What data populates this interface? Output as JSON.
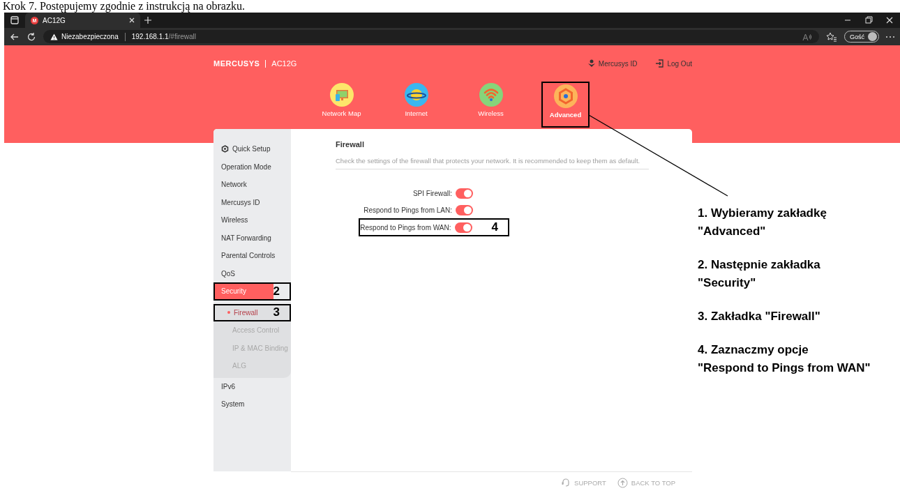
{
  "caption": "Krok 7. Postępujemy zgodnie z instrukcją na obrazku.",
  "browser": {
    "tab_favicon": "M",
    "tab_title": "AC12G",
    "security_label": "Niezabezpieczona",
    "url_host": "192.168.1.1",
    "url_path": "/#firewall",
    "profile_label": "Gość"
  },
  "router": {
    "brand": "MERCUSYS",
    "model": "AC12G",
    "account_link": "Mercusys ID",
    "logout_link": "Log Out",
    "nav": [
      {
        "label": "Network Map",
        "kind": "network-map",
        "selected": false,
        "annotated": false
      },
      {
        "label": "Internet",
        "kind": "internet",
        "selected": false,
        "annotated": false
      },
      {
        "label": "Wireless",
        "kind": "wireless",
        "selected": false,
        "annotated": false
      },
      {
        "label": "Advanced",
        "kind": "advanced",
        "selected": true,
        "annotated": true
      }
    ],
    "sidebar": [
      {
        "label": "Quick Setup",
        "kind": "setup",
        "selected": false
      },
      {
        "label": "Operation Mode",
        "kind": "item",
        "selected": false
      },
      {
        "label": "Network",
        "kind": "item",
        "selected": false
      },
      {
        "label": "Mercusys ID",
        "kind": "item",
        "selected": false
      },
      {
        "label": "Wireless",
        "kind": "item",
        "selected": false
      },
      {
        "label": "NAT Forwarding",
        "kind": "item",
        "selected": false
      },
      {
        "label": "Parental Controls",
        "kind": "item",
        "selected": false
      },
      {
        "label": "QoS",
        "kind": "item",
        "selected": false
      },
      {
        "label": "Security",
        "kind": "item",
        "selected": true,
        "expanded": true,
        "marker": "2",
        "children": [
          {
            "label": "Firewall",
            "selected": true,
            "marker": "3"
          },
          {
            "label": "Access Control",
            "selected": false
          },
          {
            "label": "IP & MAC Binding",
            "selected": false
          },
          {
            "label": "ALG",
            "selected": false
          }
        ]
      },
      {
        "label": "IPv6",
        "kind": "item",
        "selected": false
      },
      {
        "label": "System",
        "kind": "item",
        "selected": false
      }
    ],
    "page_title": "Firewall",
    "description": "Check the settings of the firewall that protects your network. It is recommended to keep them as default.",
    "settings": [
      {
        "label": "SPI Firewall:",
        "on": true
      },
      {
        "label": "Respond to Pings from LAN:",
        "on": true
      },
      {
        "label": "Respond to Pings from WAN:",
        "on": true,
        "marker": "4"
      }
    ],
    "footer": {
      "support": "SUPPORT",
      "back_to_top": "BACK TO TOP"
    }
  },
  "instructions": [
    {
      "lines": [
        "1. Wybieramy zakładkę",
        "\"Advanced\""
      ]
    },
    {
      "lines": [
        "2. Następnie zakładka",
        "\"Security\""
      ]
    },
    {
      "lines": [
        "3. Zakładka \"Firewall\""
      ]
    },
    {
      "lines": [
        "4. Zaznaczmy opcje",
        "\"Respond to Pings from WAN\""
      ]
    }
  ]
}
